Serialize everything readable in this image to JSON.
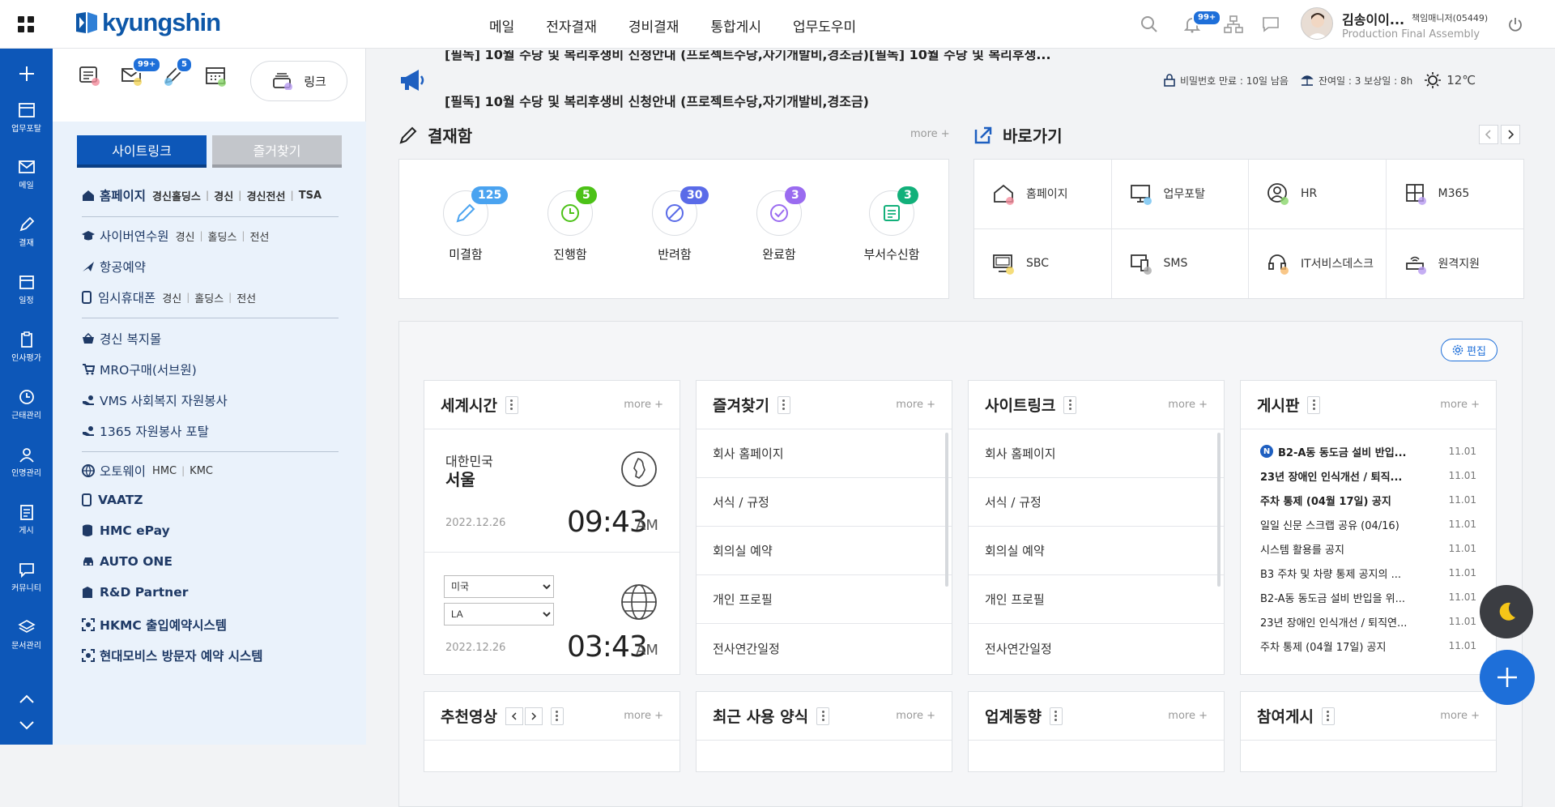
{
  "brand": {
    "logo_text": "kyungshin",
    "color": "#0d57a8"
  },
  "top_nav": [
    "메일",
    "전자결재",
    "경비결재",
    "통합게시",
    "업무도우미"
  ],
  "top_icons": {
    "notif_badge": "99+"
  },
  "user": {
    "name": "김송이이...",
    "title": "책임매니저(05449)",
    "dept": "Production Final Assembly"
  },
  "rail": [
    "업무포탈",
    "메일",
    "결재",
    "일정",
    "인사평가",
    "근태관리",
    "인명관리",
    "게시",
    "커뮤니티",
    "문서관리"
  ],
  "quick": {
    "mail_badge": "99+",
    "approve_badge": "5",
    "link_label": "링크"
  },
  "site_tabs": {
    "active": "사이트링크",
    "inactive": "즐거찾기"
  },
  "site_links": [
    {
      "label": "홈페이지",
      "subs": [
        "경신홀딩스",
        "경신",
        "경신전선",
        "TSA"
      ]
    },
    {
      "label": "사이버연수원",
      "subs": [
        "경신",
        "홀딩스",
        "전선"
      ]
    },
    {
      "label": "항공예약",
      "subs": []
    },
    {
      "label": "임시휴대폰",
      "subs": [
        "경신",
        "홀딩스",
        "전선"
      ]
    },
    {
      "label": "경신 복지몰",
      "subs": []
    },
    {
      "label": "MRO구매(서브원)",
      "subs": []
    },
    {
      "label": "VMS 사회복지 자원봉사",
      "subs": []
    },
    {
      "label": "1365 자원봉사 포탈",
      "subs": []
    },
    {
      "label": "오토웨이",
      "subs": [
        "HMC",
        "KMC"
      ]
    },
    {
      "label": "VAATZ",
      "subs": []
    },
    {
      "label": "HMC ePay",
      "subs": []
    },
    {
      "label": "AUTO ONE",
      "subs": []
    },
    {
      "label": "R&D Partner",
      "subs": []
    },
    {
      "label": "HKMC 출입예약시스템",
      "subs": []
    },
    {
      "label": "현대모비스 방문자 예약 시스템",
      "subs": []
    }
  ],
  "notice": {
    "top_line": "[필독] 10월 수당 및 복리후생비 신청안내 (프로젝트수당,자기개발비,경조금)[필독] 10월 수당 및 복리후생...",
    "line": "[필독] 10월 수당 및 복리후생비 신청안내 (프로젝트수당,자기개발비,경조금)"
  },
  "status": {
    "password": "비밀번호 만료 : 10일 남음",
    "leave": "잔여일 : 3  보상일 : 8h",
    "weather": "12℃"
  },
  "approval": {
    "title": "결재함",
    "more": "more +",
    "items": [
      {
        "label": "미결함",
        "count": "125",
        "color": "#4aa3f0"
      },
      {
        "label": "진행함",
        "count": "5",
        "color": "#4cc217"
      },
      {
        "label": "반려함",
        "count": "30",
        "color": "#5a6be8"
      },
      {
        "label": "완료함",
        "count": "3",
        "color": "#9a6bf0"
      },
      {
        "label": "부서수신함",
        "count": "3",
        "color": "#12b07a"
      }
    ]
  },
  "shortcuts": {
    "title": "바로가기",
    "items": [
      "홈페이지",
      "업무포탈",
      "HR",
      "M365",
      "SBC",
      "SMS",
      "IT서비스데스크",
      "원격지원"
    ]
  },
  "edit_label": "편집",
  "worldclock": {
    "title": "세계시간",
    "more": "more +",
    "country": "대한민국",
    "city": "서울",
    "date1": "2022.12.26",
    "time1": "09:43",
    "ampm1": "AM",
    "select_country": "미국",
    "select_city": "LA",
    "date2": "2022.12.26",
    "time2": "03:43",
    "ampm2": "AM"
  },
  "favorites": {
    "title": "즐겨찾기",
    "more": "more +",
    "items": [
      "회사 홈페이지",
      "서식 / 규정",
      "회의실 예약",
      "개인 프로필",
      "전사연간일정"
    ]
  },
  "sitelink_widget": {
    "title": "사이트링크",
    "more": "more +",
    "items": [
      "회사 홈페이지",
      "서식 / 규정",
      "회의실 예약",
      "개인 프로필",
      "전사연간일정"
    ]
  },
  "board": {
    "title": "게시판",
    "more": "more +",
    "rows": [
      {
        "text": "B2-A동 동도금 설비 반입...",
        "date": "11.01",
        "bold": true,
        "new": "N"
      },
      {
        "text": "23년 장애인 인식개선 / 퇴직...",
        "date": "11.01",
        "bold": true
      },
      {
        "text": "주차 통제 (04월 17일) 공지",
        "date": "11.01",
        "bold": true
      },
      {
        "text": "일일 신문 스크랩 공유 (04/16)",
        "date": "11.01",
        "bold": false
      },
      {
        "text": "시스템 활용를 공지",
        "date": "11.01",
        "bold": false
      },
      {
        "text": "B3 주차 및 차량 통제 공지의 ...",
        "date": "11.01",
        "bold": false
      },
      {
        "text": "B2-A동 동도금 설비 반입을 위...",
        "date": "11.01",
        "bold": false
      },
      {
        "text": "23년 장애인 인식개선 / 퇴직연...",
        "date": "11.01",
        "bold": false
      },
      {
        "text": "주차 통제 (04월 17일) 공지",
        "date": "11.01",
        "bold": false
      }
    ]
  },
  "bottom_widgets": [
    {
      "title": "추천영상",
      "more": "more +"
    },
    {
      "title": "최근 사용 양식",
      "more": "more +"
    },
    {
      "title": "업계동향",
      "more": "more +"
    },
    {
      "title": "참여게시",
      "more": "more +"
    }
  ]
}
